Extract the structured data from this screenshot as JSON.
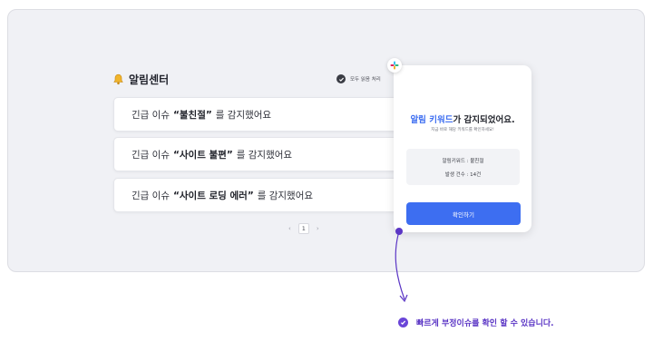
{
  "panel": {
    "title": "알림센터",
    "mark_all_read": "모두 읽음 처리",
    "rows": [
      {
        "prefix": "긴급 이슈",
        "keyword": "“불친절”",
        "suffix": "를 감지했어요"
      },
      {
        "prefix": "긴급 이슈",
        "keyword": "“사이트 불편”",
        "suffix": "를 감지했어요"
      },
      {
        "prefix": "긴급 이슈",
        "keyword": "“사이트 로딩 에러”",
        "suffix": "를 감지했어요"
      }
    ],
    "pagination": {
      "prev": "‹",
      "current": "1",
      "next": "›"
    }
  },
  "card": {
    "title_keyword": "알림 키워드",
    "title_rest": "가 감지되었어요.",
    "subtitle": "지금 바로 해당 키워드를 확인하세요!",
    "keyword_line": "알림키워드 : 불친절",
    "count_line": "발생 건수 : 14건",
    "confirm_button": "확인하기"
  },
  "footnote": "빠르게 부정이슈를 확인 할 수 있습니다.",
  "colors": {
    "accent": "#3d6ef1",
    "purple": "#6a45d8",
    "background": "#f0f1f5"
  }
}
